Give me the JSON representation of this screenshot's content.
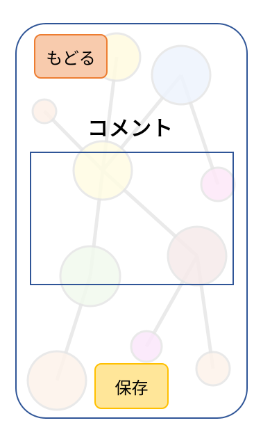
{
  "header": {
    "back_label": "もどる"
  },
  "main": {
    "title": "コメント",
    "comment_value": ""
  },
  "footer": {
    "save_label": "保存"
  },
  "colors": {
    "frame_border": "#2f5597",
    "back_fill": "#f8cbad",
    "back_border": "#ed7d31",
    "save_fill": "#ffe699",
    "save_border": "#ffc000"
  },
  "background_graph": {
    "icon": "network-graph-illustration"
  }
}
